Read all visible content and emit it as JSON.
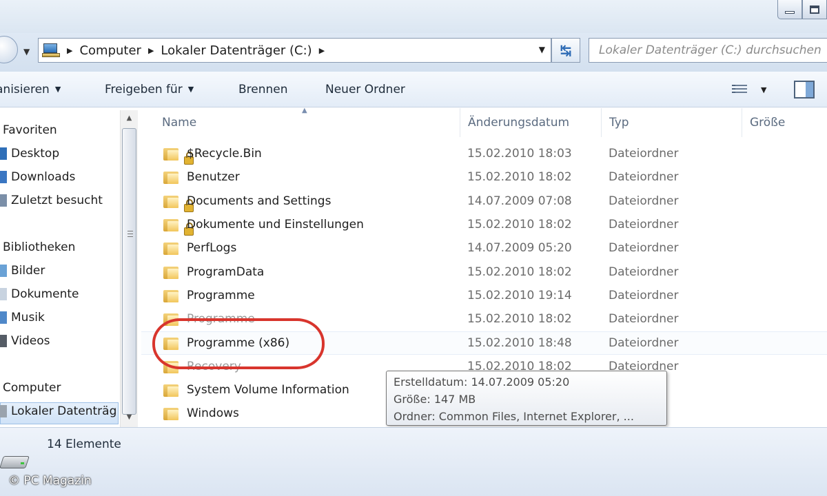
{
  "window": {
    "controls": [
      "minimize",
      "maximize"
    ]
  },
  "address": {
    "crumbs": [
      "Computer",
      "Lokaler Datenträger (C:)"
    ],
    "search_placeholder": "Lokaler Datenträger (C:) durchsuchen"
  },
  "toolbar": {
    "organize_label": "anisieren",
    "share_label": "Freigeben für",
    "burn_label": "Brennen",
    "new_folder_label": "Neuer Ordner"
  },
  "nav": {
    "favorites_header": "Favoriten",
    "favorites": [
      "Desktop",
      "Downloads",
      "Zuletzt besucht"
    ],
    "libraries_header": "Bibliotheken",
    "libraries": [
      "Bilder",
      "Dokumente",
      "Musik",
      "Videos"
    ],
    "computer_header": "Computer",
    "computer_items": [
      "Lokaler Datenträg"
    ]
  },
  "columns": {
    "name": "Name",
    "date": "Änderungsdatum",
    "type": "Typ",
    "size": "Größe"
  },
  "files": [
    {
      "name": "$Recycle.Bin",
      "date": "15.02.2010 18:03",
      "type": "Dateiordner",
      "icon": "locked-folder-icon"
    },
    {
      "name": "Benutzer",
      "date": "15.02.2010 18:02",
      "type": "Dateiordner",
      "icon": "folder-icon"
    },
    {
      "name": "Documents and Settings",
      "date": "14.07.2009 07:08",
      "type": "Dateiordner",
      "icon": "locked-folder-icon"
    },
    {
      "name": "Dokumente und Einstellungen",
      "date": "15.02.2010 18:02",
      "type": "Dateiordner",
      "icon": "locked-folder-icon"
    },
    {
      "name": "PerfLogs",
      "date": "14.07.2009 05:20",
      "type": "Dateiordner",
      "icon": "folder-icon"
    },
    {
      "name": "ProgramData",
      "date": "15.02.2010 18:02",
      "type": "Dateiordner",
      "icon": "folder-icon"
    },
    {
      "name": "Programme",
      "date": "15.02.2010 19:14",
      "type": "Dateiordner",
      "icon": "folder-icon"
    },
    {
      "name": "Programme",
      "date": "15.02.2010 18:02",
      "type": "Dateiordner",
      "icon": "folder-icon"
    },
    {
      "name": "Programme (x86)",
      "date": "15.02.2010 18:48",
      "type": "Dateiordner",
      "icon": "folder-icon"
    },
    {
      "name": "Recovery",
      "date": "15.02.2010 18:02",
      "type": "Dateiordner",
      "icon": "folder-icon"
    },
    {
      "name": "System Volume Information",
      "date": "",
      "type": "",
      "icon": "folder-icon"
    },
    {
      "name": "Windows",
      "date": "",
      "type": "",
      "icon": "folder-icon"
    }
  ],
  "tooltip": {
    "created": "Erstelldatum: 14.07.2009 05:20",
    "size": "Größe: 147 MB",
    "folders": "Ordner: Common Files, Internet Explorer, ..."
  },
  "status": {
    "count": "14 Elemente"
  },
  "watermark": "© PC Magazin",
  "colors": {
    "highlight_oval": "#d8352d",
    "selection": "#cfe2f7"
  }
}
